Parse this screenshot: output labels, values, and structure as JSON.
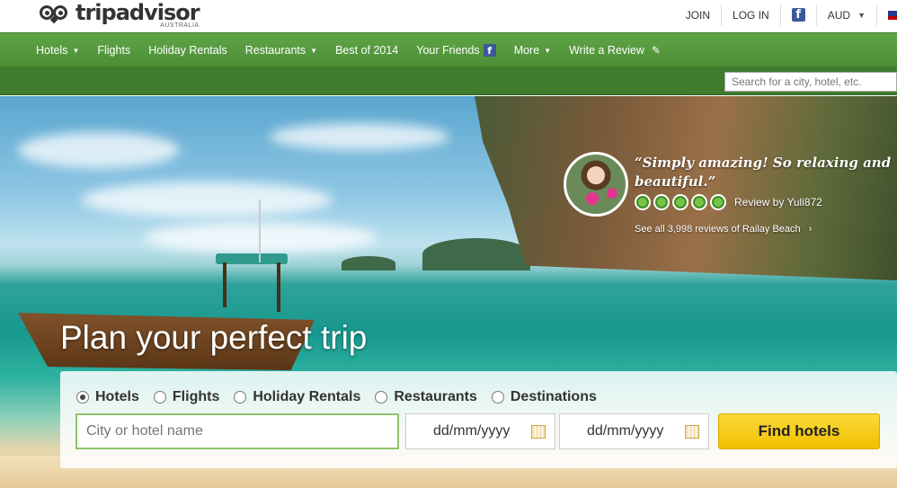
{
  "header": {
    "logo_text": "tripadvisor",
    "logo_sub": "AUSTRALIA",
    "links": {
      "join": "JOIN",
      "login": "LOG IN",
      "currency": "AUD"
    },
    "facebook_glyph": "f"
  },
  "nav": {
    "items": [
      {
        "label": "Hotels",
        "has_dropdown": true
      },
      {
        "label": "Flights",
        "has_dropdown": false
      },
      {
        "label": "Holiday Rentals",
        "has_dropdown": false
      },
      {
        "label": "Restaurants",
        "has_dropdown": true
      },
      {
        "label": "Best of 2014",
        "has_dropdown": false
      },
      {
        "label": "Your Friends",
        "has_dropdown": false
      },
      {
        "label": "More",
        "has_dropdown": true
      },
      {
        "label": "Write a Review",
        "has_dropdown": false
      }
    ],
    "search_placeholder": "Search for a city, hotel, etc."
  },
  "review": {
    "quote": "“Simply amazing! So relaxing and beautiful.”",
    "rating": 5,
    "reviewer": "Review by Yuli872",
    "see_all": "See all 3,998 reviews of Railay Beach"
  },
  "hero": {
    "headline": "Plan your perfect trip"
  },
  "search": {
    "tabs": [
      {
        "label": "Hotels",
        "selected": true
      },
      {
        "label": "Flights",
        "selected": false
      },
      {
        "label": "Holiday Rentals",
        "selected": false
      },
      {
        "label": "Restaurants",
        "selected": false
      },
      {
        "label": "Destinations",
        "selected": false
      }
    ],
    "city_placeholder": "City or hotel name",
    "checkin_placeholder": "dd/mm/yyyy",
    "checkout_placeholder": "dd/mm/yyyy",
    "submit_label": "Find hotels"
  },
  "colors": {
    "brand_green": "#589442",
    "nav_green": "#4b8e37",
    "button_yellow": "#f0c000",
    "facebook_blue": "#3b5998"
  }
}
